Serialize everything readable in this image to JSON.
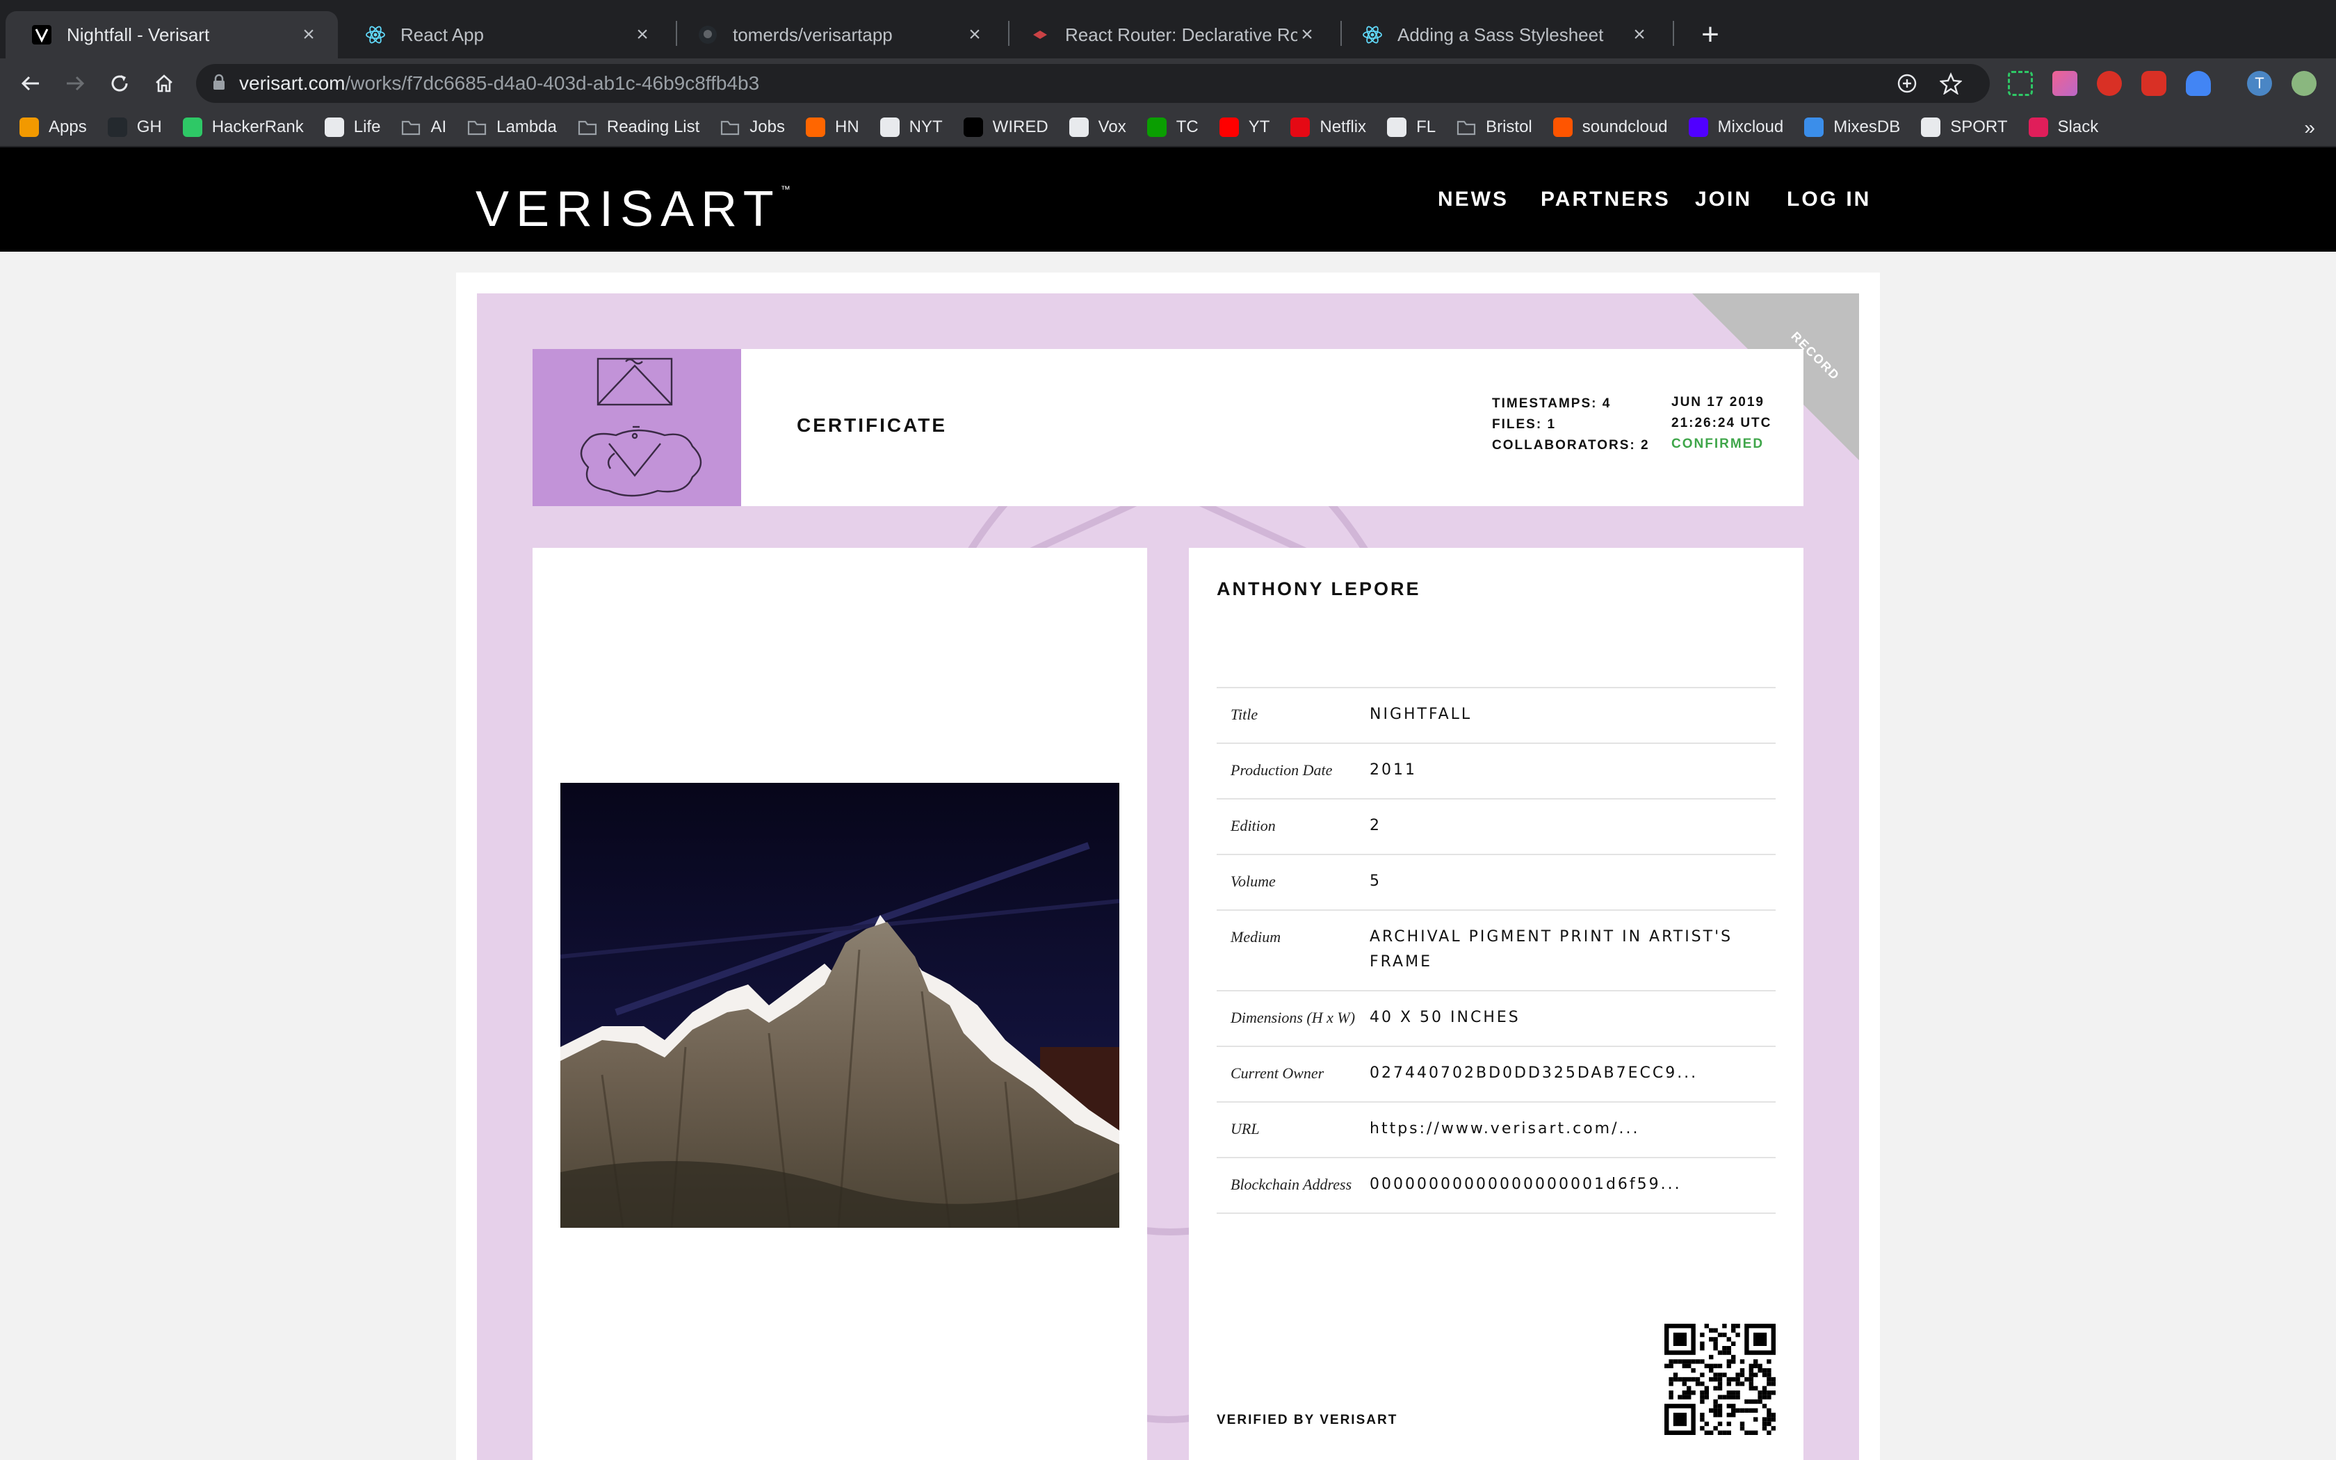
{
  "browser": {
    "tabs": [
      {
        "title": "Nightfall - Verisart",
        "active": true,
        "icon": "verisart-v-icon"
      },
      {
        "title": "React App",
        "active": false,
        "icon": "react-icon"
      },
      {
        "title": "tomerds/verisartapp",
        "active": false,
        "icon": "github-icon"
      },
      {
        "title": "React Router: Declarative Rout",
        "active": false,
        "icon": "react-router-icon"
      },
      {
        "title": "Adding a Sass Stylesheet",
        "active": false,
        "icon": "react-icon"
      }
    ],
    "new_tab_label": "+",
    "address": {
      "domain": "verisart.com",
      "path": "/works/f7dc6685-d4a0-403d-ab1c-46b9c8ffb4b3"
    },
    "profile_initial": "T",
    "bookmarks": [
      {
        "label": "Apps",
        "icon": "apps-grid-icon",
        "color": "#f29900"
      },
      {
        "label": "GH",
        "icon": "github-icon",
        "color": "#24292e"
      },
      {
        "label": "HackerRank",
        "icon": "hackerrank-icon",
        "color": "#2ec866"
      },
      {
        "label": "Life",
        "icon": "life-icon",
        "color": "#e8eaed"
      },
      {
        "label": "AI",
        "icon": "folder-icon",
        "color": "#9aa0a6"
      },
      {
        "label": "Lambda",
        "icon": "folder-icon",
        "color": "#9aa0a6"
      },
      {
        "label": "Reading List",
        "icon": "folder-icon",
        "color": "#9aa0a6"
      },
      {
        "label": "Jobs",
        "icon": "folder-icon",
        "color": "#9aa0a6"
      },
      {
        "label": "HN",
        "icon": "hackernews-icon",
        "color": "#ff6600"
      },
      {
        "label": "NYT",
        "icon": "nyt-icon",
        "color": "#e8eaed"
      },
      {
        "label": "WIRED",
        "icon": "wired-icon",
        "color": "#000000"
      },
      {
        "label": "Vox",
        "icon": "vox-icon",
        "color": "#e8eaed"
      },
      {
        "label": "TC",
        "icon": "techcrunch-icon",
        "color": "#0a9e01"
      },
      {
        "label": "YT",
        "icon": "youtube-icon",
        "color": "#ff0000"
      },
      {
        "label": "Netflix",
        "icon": "netflix-icon",
        "color": "#e50914"
      },
      {
        "label": "FL",
        "icon": "fl-icon",
        "color": "#e8eaed"
      },
      {
        "label": "Bristol",
        "icon": "folder-icon",
        "color": "#9aa0a6"
      },
      {
        "label": "soundcloud",
        "icon": "soundcloud-icon",
        "color": "#ff5500"
      },
      {
        "label": "Mixcloud",
        "icon": "mixcloud-icon",
        "color": "#5000ff"
      },
      {
        "label": "MixesDB",
        "icon": "mixesdb-icon",
        "color": "#3b8eea"
      },
      {
        "label": "SPORT",
        "icon": "bbc-sport-icon",
        "color": "#e8eaed"
      },
      {
        "label": "Slack",
        "icon": "slack-icon",
        "color": "#e01e5a"
      }
    ],
    "more_bookmarks": "»"
  },
  "site": {
    "logo": "VERISART",
    "logo_tm": "™",
    "nav": [
      "NEWS",
      "PARTNERS",
      "JOIN",
      "LOG IN"
    ]
  },
  "certificate": {
    "corner_label": "RECORD",
    "heading": "CERTIFICATE",
    "meta_labels": [
      "TIMESTAMPS: 4",
      "FILES: 1",
      "COLLABORATORS: 2"
    ],
    "date": "JUN 17 2019",
    "time": "21:26:24 UTC",
    "status": "CONFIRMED",
    "artist": "ANTHONY LEPORE",
    "details": [
      {
        "label": "Title",
        "value": "NIGHTFALL"
      },
      {
        "label": "Production Date",
        "value": "2011"
      },
      {
        "label": "Edition",
        "value": "2"
      },
      {
        "label": "Volume",
        "value": "5"
      },
      {
        "label": "Medium",
        "value": "ARCHIVAL PIGMENT PRINT IN ARTIST'S FRAME"
      },
      {
        "label": "Dimensions (H x W)",
        "value": "40 X 50 INCHES"
      },
      {
        "label": "Current Owner",
        "value": "027440702BD0DD325DAB7ECC9..."
      },
      {
        "label": "URL",
        "value": "https://www.verisart.com/..."
      },
      {
        "label": "Blockchain Address",
        "value": "00000000000000000001d6f59..."
      }
    ],
    "verified": "VERIFIED BY VERISART"
  },
  "colors": {
    "certificate_bg": "#e6d0ea",
    "thumb_bg": "#c293d8",
    "confirmed": "#3fa64a",
    "corner": "#bfbfbf"
  }
}
